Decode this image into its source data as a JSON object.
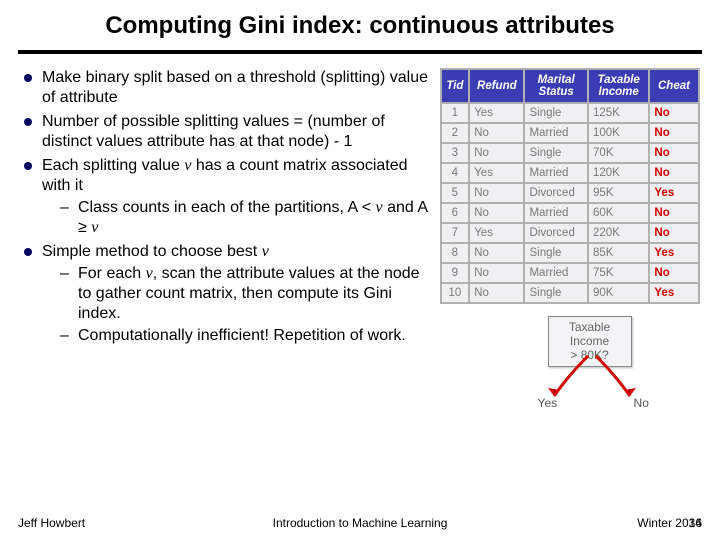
{
  "title": "Computing Gini index: continuous attributes",
  "bullets": {
    "b1": "Make binary split based on a threshold (splitting) value of attribute",
    "b2": "Number of possible splitting values = (number of distinct values attribute has at that node) - 1",
    "b3_pre": "Each splitting value ",
    "b3_v": "v",
    "b3_post": " has a count matrix associated with it",
    "b3a_pre": "Class counts in each of the partitions, A < ",
    "b3a_v1": "v",
    "b3a_mid": " and A ≥ ",
    "b3a_v2": "v",
    "b4_pre": "Simple method to choose best ",
    "b4_v": "v",
    "b4a_pre": "For each ",
    "b4a_v": "v",
    "b4a_post": ", scan the attribute values at the node to gather count matrix, then compute its Gini index.",
    "b4b": "Computationally inefficient! Repetition of work."
  },
  "table": {
    "headers": [
      "Tid",
      "Refund",
      "Marital Status",
      "Taxable Income",
      "Cheat"
    ],
    "rows": [
      [
        "1",
        "Yes",
        "Single",
        "125K",
        "No"
      ],
      [
        "2",
        "No",
        "Married",
        "100K",
        "No"
      ],
      [
        "3",
        "No",
        "Single",
        "70K",
        "No"
      ],
      [
        "4",
        "Yes",
        "Married",
        "120K",
        "No"
      ],
      [
        "5",
        "No",
        "Divorced",
        "95K",
        "Yes"
      ],
      [
        "6",
        "No",
        "Married",
        "60K",
        "No"
      ],
      [
        "7",
        "Yes",
        "Divorced",
        "220K",
        "No"
      ],
      [
        "8",
        "No",
        "Single",
        "85K",
        "Yes"
      ],
      [
        "9",
        "No",
        "Married",
        "75K",
        "No"
      ],
      [
        "10",
        "No",
        "Single",
        "90K",
        "Yes"
      ]
    ]
  },
  "split": {
    "line1": "Taxable",
    "line2": "Income",
    "line3": "> 80K?",
    "yes": "Yes",
    "no": "No"
  },
  "footer": {
    "left": "Jeff Howbert",
    "center": "Introduction to Machine Learning",
    "right": "Winter 2014",
    "page": "36"
  }
}
